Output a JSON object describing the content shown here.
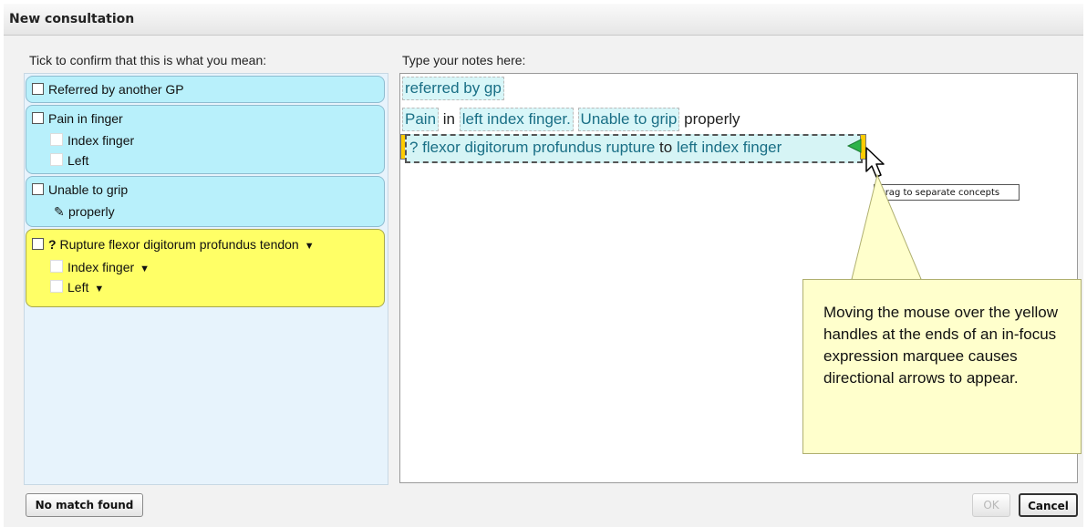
{
  "dialog": {
    "title": "New consultation"
  },
  "left": {
    "heading": "Tick to confirm that this is what you mean:",
    "groups": [
      {
        "label": "Referred by another GP"
      },
      {
        "label": "Pain in finger",
        "subs": [
          "Index finger",
          "Left"
        ]
      },
      {
        "label": "Unable to grip",
        "subs": [
          "properly"
        ]
      },
      {
        "prefix": "?",
        "label": "Rupture flexor digitorum profundus tendon",
        "subs": [
          "Index finger",
          "Left"
        ],
        "highlight_color": "#ffff66"
      }
    ]
  },
  "right": {
    "heading": "Type your notes here:",
    "line1": {
      "chip": "referred by gp"
    },
    "line2": {
      "chip1": "Pain",
      "word1": "in",
      "chip2": "left index finger.",
      "chip3": "Unable to grip",
      "word2": "properly"
    },
    "line3": {
      "chip1": "? flexor digitorum profundus rupture",
      "word": "to",
      "chip2": "left index finger"
    },
    "tooltip": "Drag to separate concepts",
    "callout": "Moving the mouse over the yellow handles at the ends of an in-focus expression marquee causes directional arrows to appear."
  },
  "buttons": {
    "no_match": "No match found",
    "ok": "OK",
    "cancel": "Cancel"
  },
  "colors": {
    "chip_bg": "#d8f6f8",
    "group_bg": "#b8f0fb",
    "handle": "#ffcc00"
  }
}
